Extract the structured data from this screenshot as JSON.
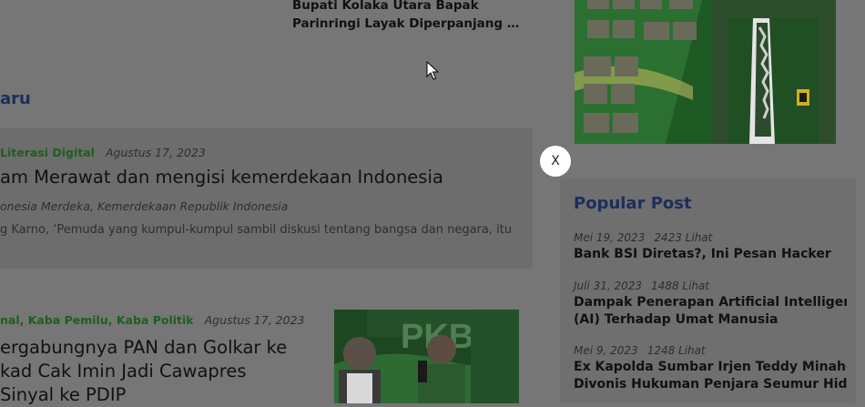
{
  "top_article": {
    "title_lines": [
      "Bupati Kolaka Utara Bapak",
      "Parinringi Layak Diperpanjang Mas..."
    ]
  },
  "section": {
    "title": "aru"
  },
  "article1": {
    "category": "Literasi Digital",
    "date": "Agustus 17, 2023",
    "title": "am Merawat dan mengisi kemerdekaan Indonesia",
    "tags": "onesia Merdeka, Kemerdekaan Republik Indonesia",
    "excerpt": "g Karno, ‘Pemuda yang kumpul-kumpul sambil diskusi tentang bangsa dan negara, itu"
  },
  "article2": {
    "categories": [
      "nal",
      "Kaba Pemilu",
      "Kaba Politik"
    ],
    "date": "Agustus 17, 2023",
    "title_lines": [
      "ergabungnya PAN dan Golkar ke",
      "kad Cak Imin Jadi Cawapres",
      "Sinyal ke PDIP"
    ],
    "thumb_text": "PKB"
  },
  "close_button": {
    "label": "X"
  },
  "popular": {
    "title": "Popular Post",
    "items": [
      {
        "date": "Mei 19, 2023",
        "views": "2423 Lihat",
        "title_lines": [
          "Bank BSI Diretas?, Ini Pesan Hacker"
        ]
      },
      {
        "date": "Juli 31, 2023",
        "views": "1488 Lihat",
        "title_lines": [
          "Dampak Penerapan Artificial Intelligence",
          "(AI) Terhadap Umat Manusia"
        ]
      },
      {
        "date": "Mei 9, 2023",
        "views": "1248 Lihat",
        "title_lines": [
          "Ex Kapolda Sumbar Irjen Teddy Minahesa",
          "Divonis Hukuman Penjara Seumur Hidu..."
        ]
      }
    ]
  },
  "colors": {
    "overlay": "#767676",
    "accent_green": "#1f5e1f",
    "heading_blue": "#1c2e5c"
  }
}
